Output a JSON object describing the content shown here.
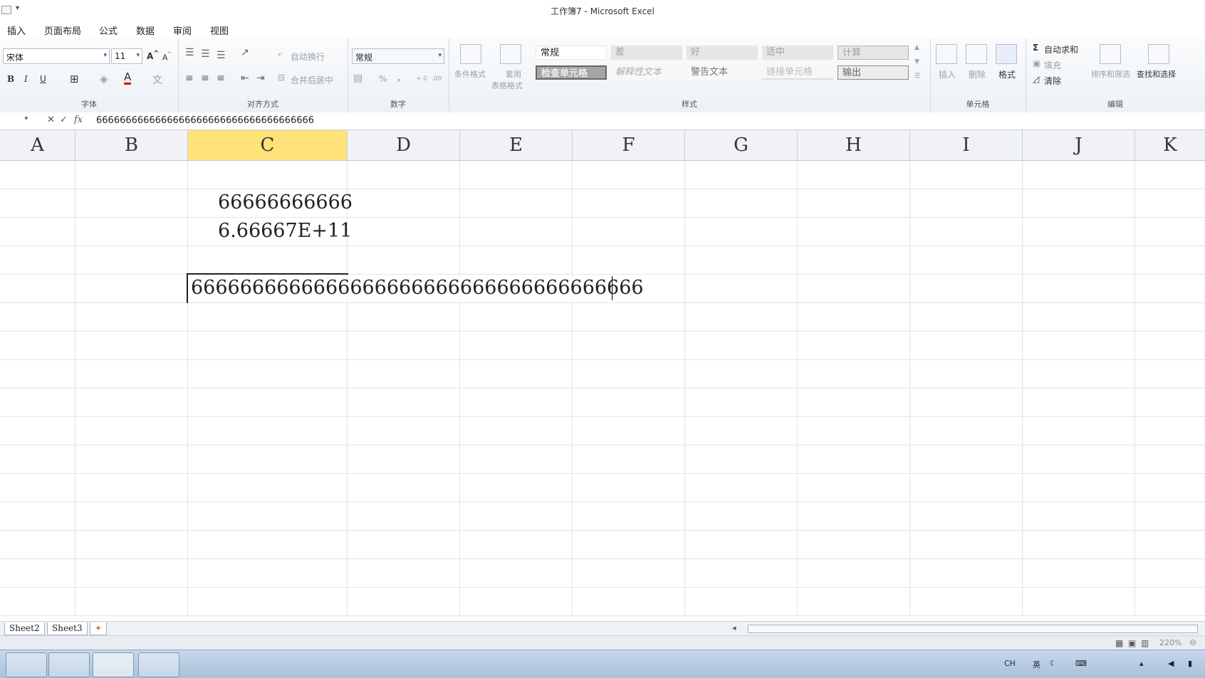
{
  "window": {
    "title": "工作簿7 - Microsoft Excel"
  },
  "menu": {
    "tabs": [
      "插入",
      "页面布局",
      "公式",
      "数据",
      "审阅",
      "视图"
    ]
  },
  "ribbon": {
    "font": {
      "name": "宋体",
      "size": "11",
      "group_label": "字体"
    },
    "alignment": {
      "wrap_text": "自动换行",
      "merge_center": "合并后居中",
      "group_label": "对齐方式"
    },
    "number": {
      "format": "常规",
      "group_label": "数字"
    },
    "styles": {
      "conditional_format": "条件格式",
      "table_format_line1": "套用",
      "table_format_line2": "表格格式",
      "cells_row1": [
        "常规",
        "差",
        "好",
        "适中",
        "计算"
      ],
      "cells_row2": [
        "检查单元格",
        "解释性文本",
        "警告文本",
        "链接单元格",
        "输出"
      ],
      "group_label": "样式"
    },
    "cells": {
      "insert": "插入",
      "delete": "删除",
      "format": "格式",
      "group_label": "单元格"
    },
    "editing": {
      "autosum": "自动求和",
      "fill": "填充",
      "clear": "清除",
      "sort_filter": "排序和筛选",
      "find_select": "查找和选择",
      "group_label": "编辑"
    }
  },
  "formula_bar": {
    "content": "6666666666666666666666666666666666666"
  },
  "columns": [
    "A",
    "B",
    "C",
    "D",
    "E",
    "F",
    "G",
    "H",
    "I",
    "J",
    "K"
  ],
  "cells": {
    "c3": "66666666666",
    "c4": "6.66667E+11",
    "c6_editing": "6666666666666666666666666666666666666"
  },
  "sheets": [
    "Sheet2",
    "Sheet3"
  ],
  "status": {
    "zoom": "220%"
  },
  "tray": {
    "lang": "CH",
    "ime": "英"
  },
  "colors": {
    "selected_column": "#ffe27a",
    "ribbon_bg": "#edf1f6",
    "taskbar": "#a9c1da"
  }
}
